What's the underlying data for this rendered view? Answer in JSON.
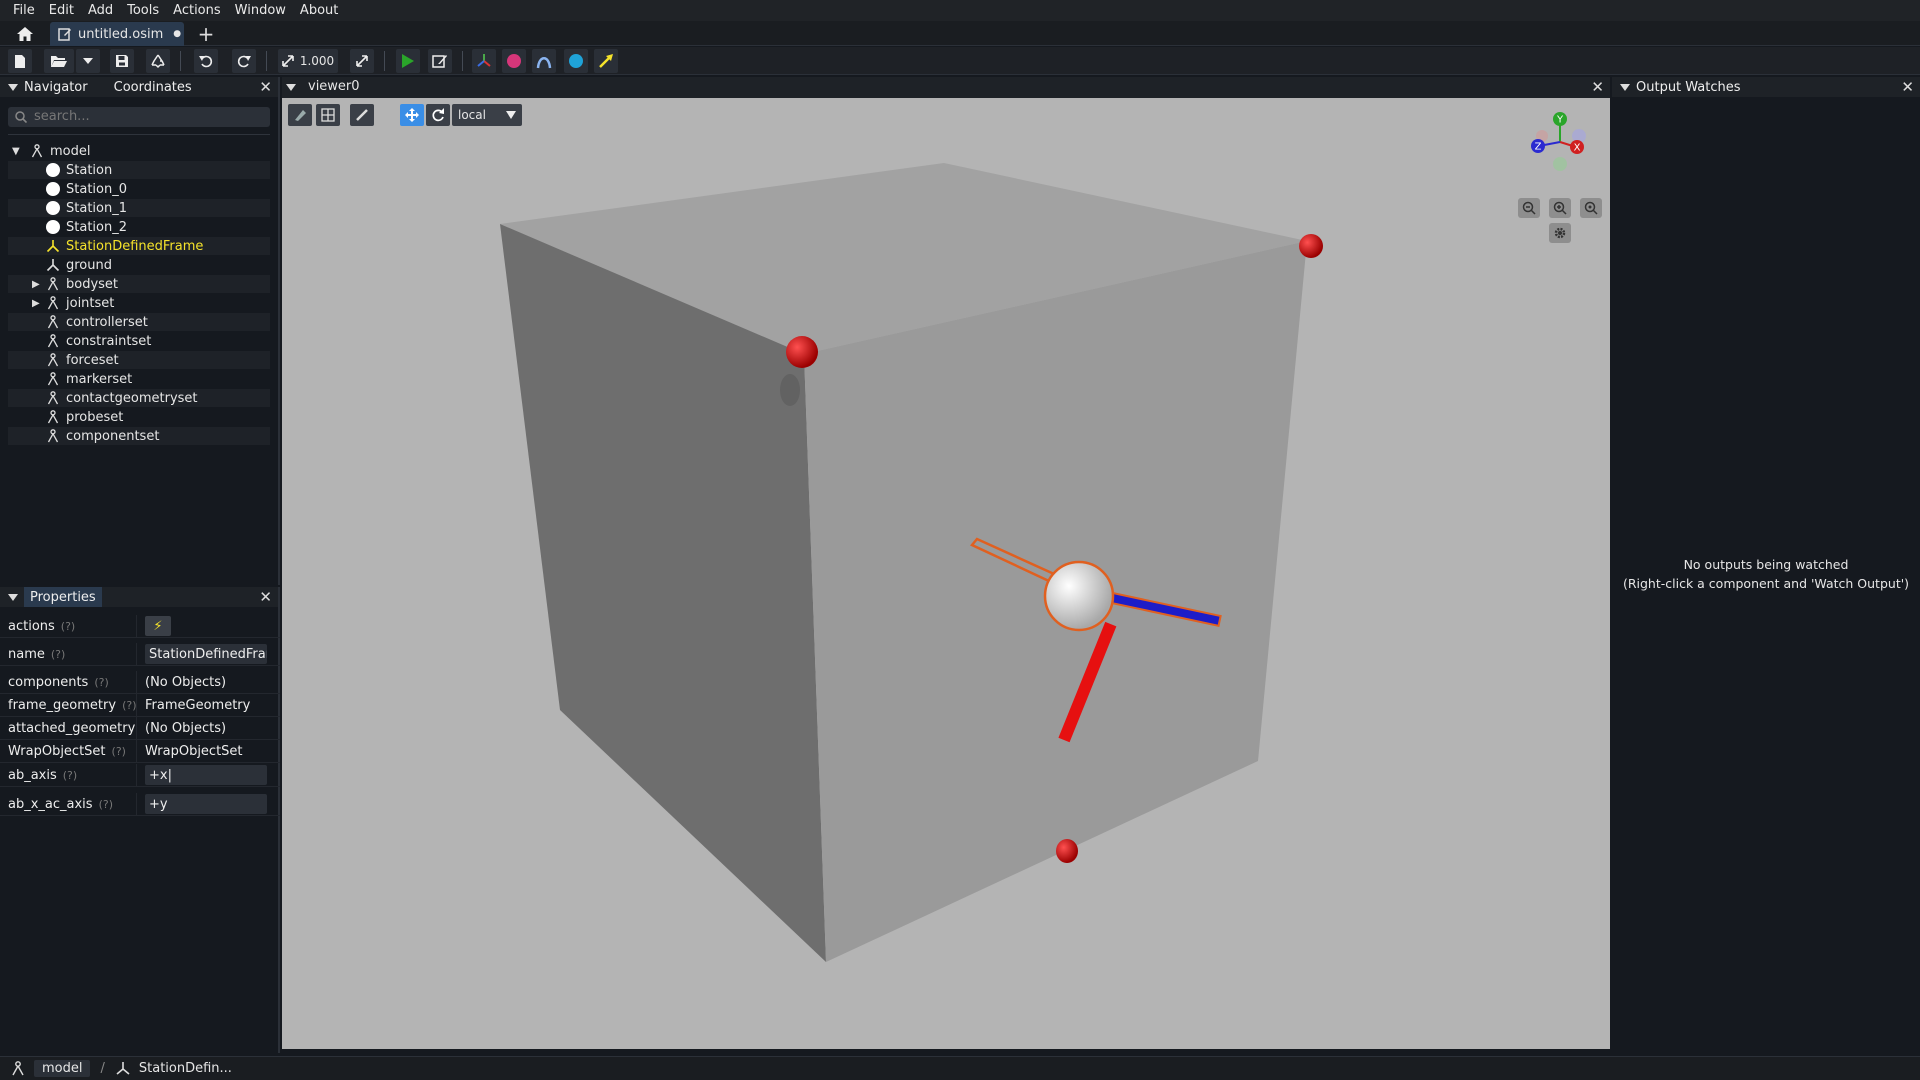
{
  "menu": [
    "File",
    "Edit",
    "Add",
    "Tools",
    "Actions",
    "Window",
    "About"
  ],
  "tabs": {
    "doc_title": "untitled.osim",
    "unsaved_dot": "●",
    "add": "+"
  },
  "toolbar": {
    "scale_value": "1.000"
  },
  "navigator": {
    "tab_navigator": "Navigator",
    "tab_coordinates": "Coordinates",
    "search_placeholder": "search...",
    "tree": [
      {
        "label": "model",
        "icon": "component-icon",
        "level": 0,
        "expander": "▼"
      },
      {
        "label": "Station",
        "icon": "station-icon",
        "level": 1
      },
      {
        "label": "Station_0",
        "icon": "station-icon",
        "level": 1
      },
      {
        "label": "Station_1",
        "icon": "station-icon",
        "level": 1
      },
      {
        "label": "Station_2",
        "icon": "station-icon",
        "level": 1
      },
      {
        "label": "StationDefinedFrame",
        "icon": "frame-icon",
        "level": 1,
        "selected": true
      },
      {
        "label": "ground",
        "icon": "frame-icon",
        "level": 1
      },
      {
        "label": "bodyset",
        "icon": "component-icon",
        "level": 1,
        "expander": "▶"
      },
      {
        "label": "jointset",
        "icon": "component-icon",
        "level": 1,
        "expander": "▶"
      },
      {
        "label": "controllerset",
        "icon": "component-icon",
        "level": 1
      },
      {
        "label": "constraintset",
        "icon": "component-icon",
        "level": 1
      },
      {
        "label": "forceset",
        "icon": "component-icon",
        "level": 1
      },
      {
        "label": "markerset",
        "icon": "component-icon",
        "level": 1
      },
      {
        "label": "contactgeometryset",
        "icon": "component-icon",
        "level": 1
      },
      {
        "label": "probeset",
        "icon": "component-icon",
        "level": 1
      },
      {
        "label": "componentset",
        "icon": "component-icon",
        "level": 1
      }
    ]
  },
  "properties": {
    "title": "Properties",
    "help_marker": "(?)",
    "rows": [
      {
        "label": "actions",
        "value": "⚡",
        "kind": "button"
      },
      {
        "label": "name",
        "value": "StationDefinedFram",
        "kind": "input"
      },
      {
        "label": "components",
        "value": "(No Objects)",
        "kind": "text"
      },
      {
        "label": "frame_geometry",
        "value": "FrameGeometry",
        "kind": "text"
      },
      {
        "label": "attached_geometry",
        "value": "(No Objects)",
        "kind": "text"
      },
      {
        "label": "WrapObjectSet",
        "value": "WrapObjectSet",
        "kind": "text"
      },
      {
        "label": "ab_axis",
        "value": "+x|",
        "kind": "input"
      },
      {
        "label": "ab_x_ac_axis",
        "value": "+y",
        "kind": "input"
      }
    ]
  },
  "viewer": {
    "title": "viewer0",
    "frame_mode": "local",
    "axes": {
      "y": "Y",
      "x": "X",
      "z": "Z"
    }
  },
  "output_watches": {
    "title": "Output Watches",
    "empty_line1": "No outputs being watched",
    "empty_line2": "(Right-click a component and 'Watch Output')"
  },
  "statusbar": {
    "crumb_model": "model",
    "separator": "/",
    "crumb_current": "StationDefin..."
  },
  "colors": {
    "accent": "#3a8ee6",
    "selected_text": "#f5e32b",
    "marker_red": "#d10000",
    "viewport_bg": "#b4b4b4"
  }
}
